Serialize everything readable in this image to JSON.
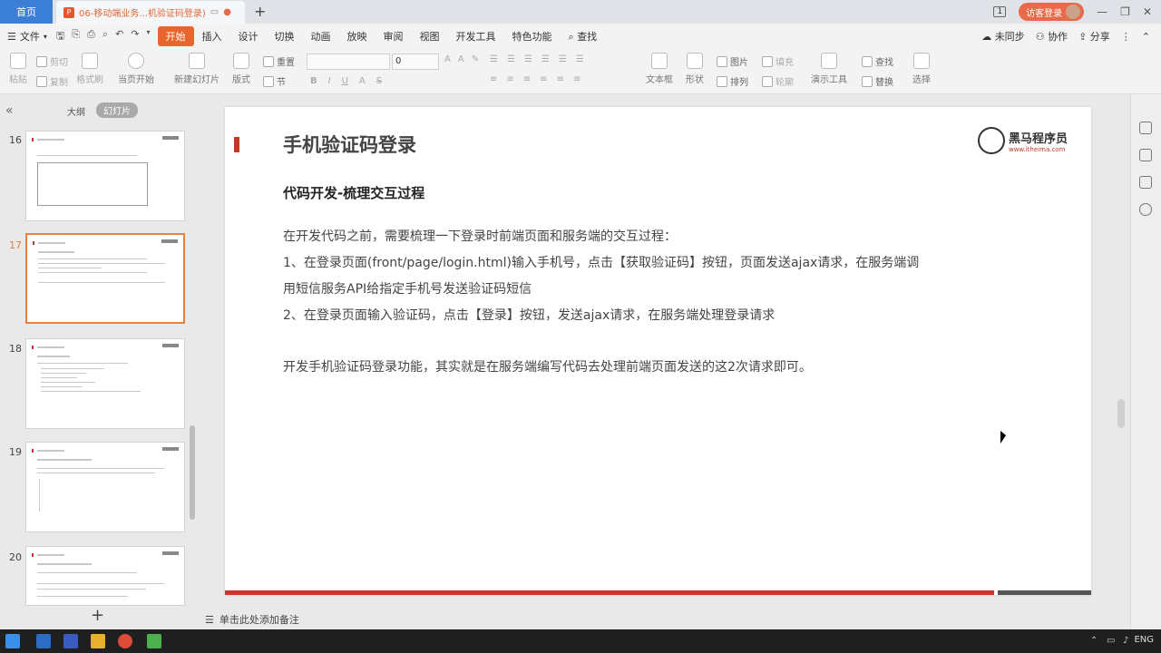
{
  "tabs": {
    "home": "首页",
    "doc_title": "06-移动端业务...机验证码登录)",
    "new_tab": "+"
  },
  "titlebar_right": {
    "page_indicator": "1",
    "login_label": "访客登录"
  },
  "menu": {
    "file": "文件",
    "items": [
      "开始",
      "插入",
      "设计",
      "切换",
      "动画",
      "放映",
      "审阅",
      "视图",
      "开发工具",
      "特色功能"
    ],
    "active_index": 0,
    "search": "查找",
    "sync": "未同步",
    "collab": "协作",
    "share": "分享"
  },
  "ribbon": {
    "paste": "粘贴",
    "cut": "剪切",
    "copy": "复制",
    "format_painter": "格式刷",
    "from_current": "当页开始",
    "new_slide": "新建幻灯片",
    "layout": "版式",
    "section": "节",
    "reset": "重置",
    "font_size": "0",
    "textbox": "文本框",
    "shape": "形状",
    "picture": "图片",
    "arrange": "排列",
    "fill": "填充",
    "outline": "轮廓",
    "present_tools": "演示工具",
    "find": "查找",
    "replace": "替换",
    "select": "选择"
  },
  "left_panel": {
    "outline_tab": "大纲",
    "slides_tab": "幻灯片",
    "thumbnails": [
      {
        "number": "16",
        "active": false
      },
      {
        "number": "17",
        "active": true
      },
      {
        "number": "18",
        "active": false
      },
      {
        "number": "19",
        "active": false
      },
      {
        "number": "20",
        "active": false
      }
    ],
    "add": "+"
  },
  "slide": {
    "title": "手机验证码登录",
    "logo_name": "黑马程序员",
    "logo_url": "www.itheima.com",
    "subtitle": "代码开发-梳理交互过程",
    "lines": [
      "在开发代码之前，需要梳理一下登录时前端页面和服务端的交互过程：",
      "1、在登录页面(front/page/login.html)输入手机号，点击【获取验证码】按钮，页面发送ajax请求，在服务端调",
      "用短信服务API给指定手机号发送验证码短信",
      "2、在登录页面输入验证码，点击【登录】按钮，发送ajax请求，在服务端处理登录请求",
      "开发手机验证码登录功能，其实就是在服务端编写代码去处理前端页面发送的这2次请求即可。"
    ]
  },
  "notes": {
    "placeholder": "单击此处添加备注"
  },
  "taskbar": {
    "language": "ENG"
  },
  "colors": {
    "accent": "#e8662e",
    "title_red": "#c0392b",
    "home_tab": "#3b7ed6"
  }
}
